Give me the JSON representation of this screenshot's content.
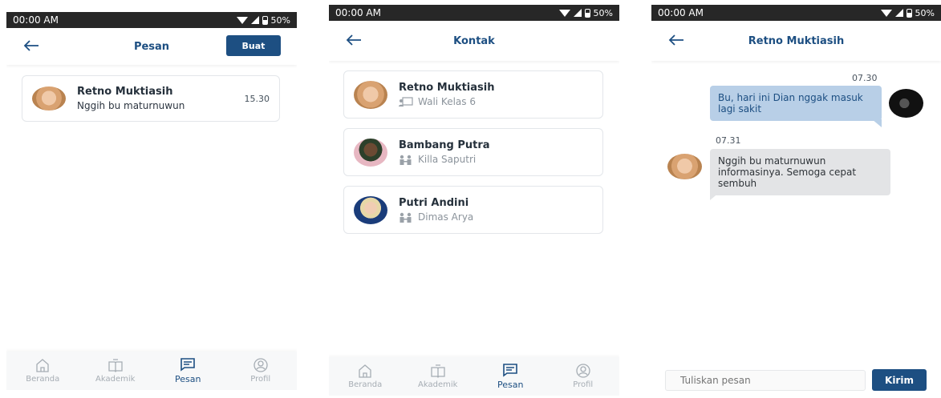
{
  "status_bar": {
    "time": "00:00 AM",
    "battery": "50%"
  },
  "screen_messages": {
    "title": "Pesan",
    "create_button": "Buat",
    "messages": [
      {
        "name": "Retno Muktiasih",
        "preview": "Nggih bu maturnuwun",
        "time": "15.30"
      }
    ]
  },
  "screen_contacts": {
    "title": "Kontak",
    "contacts": [
      {
        "name": "Retno Muktiasih",
        "subtitle": "Wali Kelas 6",
        "icon": "teacher-icon"
      },
      {
        "name": "Bambang Putra",
        "subtitle": "Killa Saputri",
        "icon": "parent-child-icon"
      },
      {
        "name": "Putri Andini",
        "subtitle": "Dimas Arya",
        "icon": "parent-child-icon"
      }
    ]
  },
  "screen_chat": {
    "title": "Retno Muktiasih",
    "messages": [
      {
        "direction": "out",
        "time": "07.30",
        "text": "Bu, hari ini Dian nggak masuk lagi sakit"
      },
      {
        "direction": "in",
        "time": "07.31",
        "text": "Nggih bu maturnuwun informasinya. Semoga cepat sembuh"
      }
    ],
    "input_placeholder": "Tuliskan pesan",
    "send_button": "Kirim"
  },
  "bottom_nav": {
    "items": [
      {
        "label": "Beranda",
        "icon": "home-icon"
      },
      {
        "label": "Akademik",
        "icon": "book-icon"
      },
      {
        "label": "Pesan",
        "icon": "message-icon",
        "active": true
      },
      {
        "label": "Profil",
        "icon": "profile-icon"
      }
    ]
  },
  "colors": {
    "primary": "#1d4f82",
    "bubble_out": "#b8cfe7",
    "bubble_in": "#e3e4e6",
    "status_bar": "#272727"
  }
}
